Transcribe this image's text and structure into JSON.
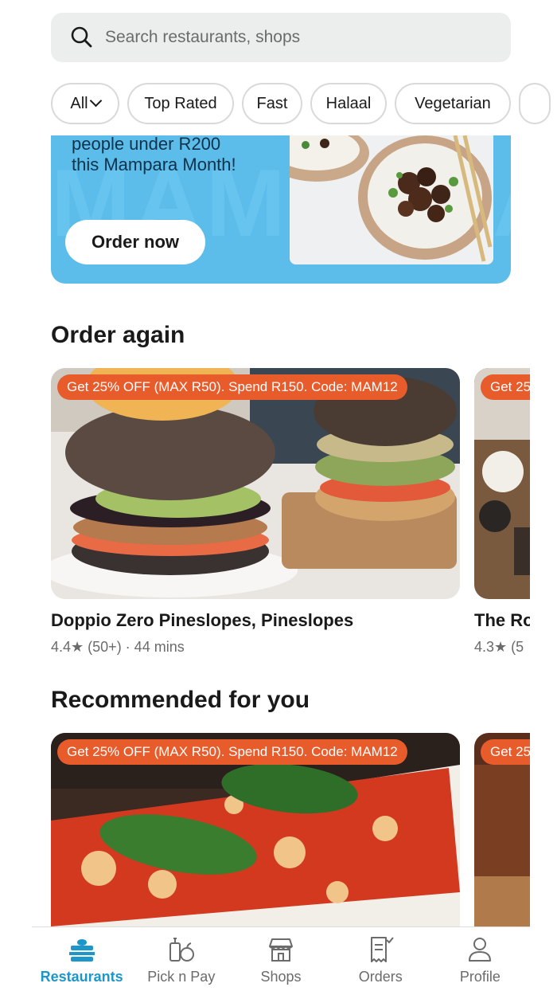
{
  "search": {
    "placeholder": "Search restaurants, shops",
    "icon": "search-icon"
  },
  "filters": [
    {
      "label": "All"
    },
    {
      "label": "Top Rated"
    },
    {
      "label": "Fast"
    },
    {
      "label": "Halaal"
    },
    {
      "label": "Vegetarian"
    }
  ],
  "banner": {
    "line1": "people under R200",
    "line2": "this Mampara Month!",
    "cta": "Order now",
    "background_word": "MAMPARA",
    "color": "#5cbcea"
  },
  "order_again": {
    "title": "Order again",
    "cards": [
      {
        "promo": "Get 25% OFF (MAX R50). Spend R150. Code: MAM12",
        "name": "Doppio Zero Pineslopes, Pineslopes",
        "meta": "4.4★ (50+) · 44 mins"
      },
      {
        "promo": "Get 25",
        "name": "The Ro",
        "meta": "4.3★ (5"
      }
    ]
  },
  "recommended": {
    "title": "Recommended for you",
    "cards": [
      {
        "promo": "Get 25% OFF (MAX R50). Spend R150. Code: MAM12"
      },
      {
        "promo": "Get 25"
      }
    ]
  },
  "nav": {
    "items": [
      {
        "label": "Restaurants",
        "icon": "restaurants-icon",
        "active": true
      },
      {
        "label": "Pick n Pay",
        "icon": "pick-n-pay-icon",
        "active": false
      },
      {
        "label": "Shops",
        "icon": "shops-icon",
        "active": false
      },
      {
        "label": "Orders",
        "icon": "orders-icon",
        "active": false
      },
      {
        "label": "Profile",
        "icon": "profile-icon",
        "active": false
      }
    ],
    "active_color": "#1d96c9"
  },
  "colors": {
    "promo": "#e85b2b",
    "accent": "#1d96c9"
  }
}
